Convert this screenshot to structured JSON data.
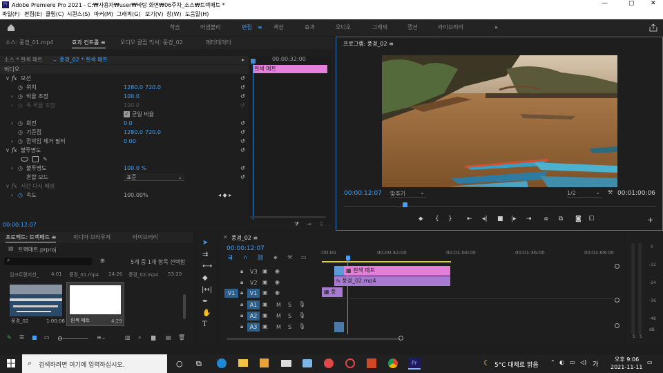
{
  "titlebar": {
    "title": "Adobe Premiere Pro 2021 - C:₩사용자₩user₩바탕 화면₩06주차_소스₩트랙매트 *"
  },
  "menubar": [
    "파일(F)",
    "편집(E)",
    "클립(C)",
    "시퀀스(S)",
    "마커(M)",
    "그래픽(G)",
    "보기(V)",
    "창(W)",
    "도움말(H)"
  ],
  "workspaces": [
    "학습",
    "어셈블리",
    "편집",
    "색상",
    "효과",
    "오디오",
    "그래픽",
    "캡션",
    "라이브러리"
  ],
  "effect_panel": {
    "tabs": [
      "소스: 풍경_01.mp4",
      "효과 컨트롤 ≡",
      "오디오 클립 믹서: 풍경_02",
      "메타데이터"
    ],
    "source": "소스 * 흰색 매트",
    "clip": "풍경_02 * 흰색 매트",
    "timecode": "00:00:32:00",
    "clip_label": "흰색 매트",
    "current_time": "00:00:12:07",
    "section_video": "비디오",
    "motion": "모션",
    "position": "위치",
    "position_x": "1280.0",
    "position_y": "720.0",
    "scale": "비율 조정",
    "scale_val": "100.0",
    "scale_width": "폭 비율 조정",
    "scale_width_val": "100.0",
    "uniform": "균일 비율",
    "rotation": "회전",
    "rotation_val": "0.0",
    "anchor": "기준점",
    "anchor_x": "1280.0",
    "anchor_y": "720.0",
    "antiflicker": "깜박임 제거 필터",
    "antiflicker_val": "0.00",
    "opacity": "불투명도",
    "opacity_sub": "불투명도",
    "opacity_val": "100.0 %",
    "blend": "혼합 모드",
    "blend_val": "표준",
    "time_remap": "시간 다시 매핑",
    "speed": "속도",
    "speed_val": "100.00%"
  },
  "program": {
    "tab": "프로그램: 풍경_02 ≡",
    "time": "00:00:12:07",
    "fit": "맞추기",
    "res": "1/2",
    "duration": "00:01:00:06"
  },
  "project": {
    "tabs": [
      "프로젝트: 트랙매트 ≡",
      "미디어 브라우저",
      "라이브러리"
    ],
    "file": "트랙매트.prproj",
    "count": "5개 중 1개 항목 선택함",
    "items_top": [
      {
        "name": "임크트랜지션_",
        "dur": "4:01"
      },
      {
        "name": "풍경_01.mp4",
        "dur": "24:26"
      },
      {
        "name": "풍경_02.mp4",
        "dur": "53:20"
      }
    ],
    "items": [
      {
        "name": "풍경_02",
        "dur": "1:00:06"
      },
      {
        "name": "흰색 매트",
        "dur": "4:29"
      }
    ]
  },
  "timeline": {
    "tab": "풍경_02 ≡",
    "time": "00:00:12:07",
    "ruler": [
      ":00:00",
      "00:00:32:00",
      "00:01:04:00",
      "00:01:36:00",
      "00:02:08:00"
    ],
    "tracks": [
      "V3",
      "V2",
      "V1",
      "A1",
      "A2",
      "A3"
    ],
    "src_v": "V1",
    "clip_v3": "흰색 매트",
    "clip_v2": "풍경_02.mp4",
    "clip_v1": "풍",
    "m": "M",
    "s": "S"
  },
  "meter": {
    "labels": [
      "0",
      "-12",
      "-24",
      "-36",
      "-48",
      "dB"
    ],
    "s": "S"
  },
  "taskbar": {
    "search": "검색하려면 여기에 입력하십시오.",
    "weather": "5°C 대체로 맑음",
    "lang": "가",
    "time": "오후 9:06",
    "date": "2021-11-11"
  }
}
